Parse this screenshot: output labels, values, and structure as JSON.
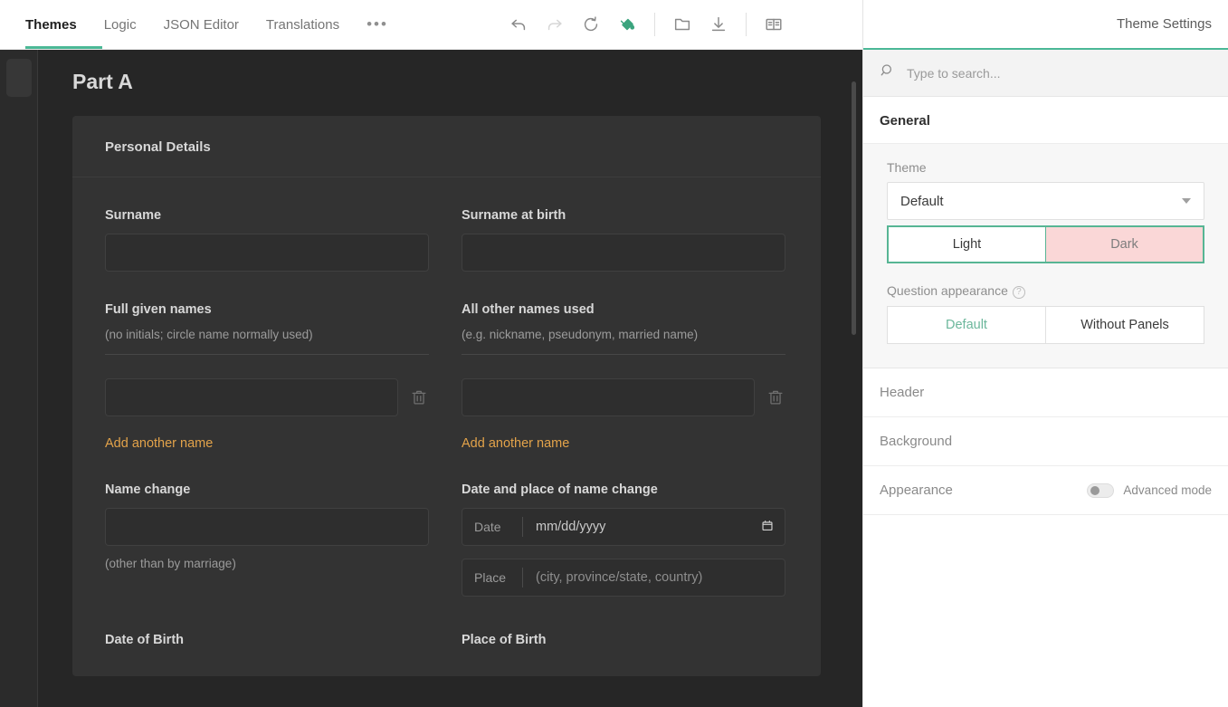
{
  "creator": {
    "tabs": [
      {
        "label": "Themes",
        "active": true
      },
      {
        "label": "Logic",
        "active": false
      },
      {
        "label": "JSON Editor",
        "active": false
      },
      {
        "label": "Translations",
        "active": false
      }
    ],
    "more_label": "•••",
    "toolbar": [
      {
        "name": "undo-icon",
        "state": "enabled"
      },
      {
        "name": "redo-icon",
        "state": "disabled"
      },
      {
        "name": "reset-icon",
        "state": "enabled"
      },
      {
        "name": "theme-fill-icon",
        "state": "accent"
      },
      {
        "name": "open-folder-icon",
        "state": "enabled"
      },
      {
        "name": "download-icon",
        "state": "enabled"
      },
      {
        "name": "preview-book-icon",
        "state": "enabled"
      }
    ],
    "accent_color": "#4bb896"
  },
  "survey": {
    "page_title": "Part A",
    "panel_title": "Personal Details",
    "questions": {
      "surname": {
        "title": "Surname",
        "value": ""
      },
      "surname_at_birth": {
        "title": "Surname at birth",
        "value": ""
      },
      "full_given_names": {
        "title": "Full given names",
        "description": "(no initials; circle name normally used)",
        "value": "",
        "add_label": "Add another name"
      },
      "all_other_names": {
        "title": "All other names used",
        "description": "(e.g. nickname, pseudonym, married name)",
        "value": "",
        "add_label": "Add another name"
      },
      "name_change": {
        "title": "Name change",
        "description": "(other than by marriage)",
        "value": ""
      },
      "date_place_name_change": {
        "title": "Date and place of name change",
        "date_label": "Date",
        "date_placeholder": "mm/dd/yyyy",
        "date_value": "",
        "place_label": "Place",
        "place_placeholder": "(city, province/state, country)",
        "place_value": ""
      },
      "date_of_birth": {
        "title": "Date of Birth"
      },
      "place_of_birth": {
        "title": "Place of Birth"
      }
    },
    "link_color": "#e3a34a"
  },
  "settings": {
    "title": "Theme Settings",
    "search": {
      "placeholder": "Type to search...",
      "value": ""
    },
    "general": {
      "header": "General",
      "theme_label": "Theme",
      "theme_value": "Default",
      "mode": {
        "light": "Light",
        "dark": "Dark",
        "selected": "Dark"
      },
      "question_appearance_label": "Question appearance",
      "appearance": {
        "default": "Default",
        "without_panels": "Without Panels",
        "selected": "Default"
      }
    },
    "sections": [
      {
        "label": "Header"
      },
      {
        "label": "Background"
      },
      {
        "label": "Appearance"
      }
    ],
    "advanced_mode": {
      "label": "Advanced mode",
      "on": false
    },
    "accent_color": "#4bb896",
    "selected_color": "#fad7d7"
  }
}
